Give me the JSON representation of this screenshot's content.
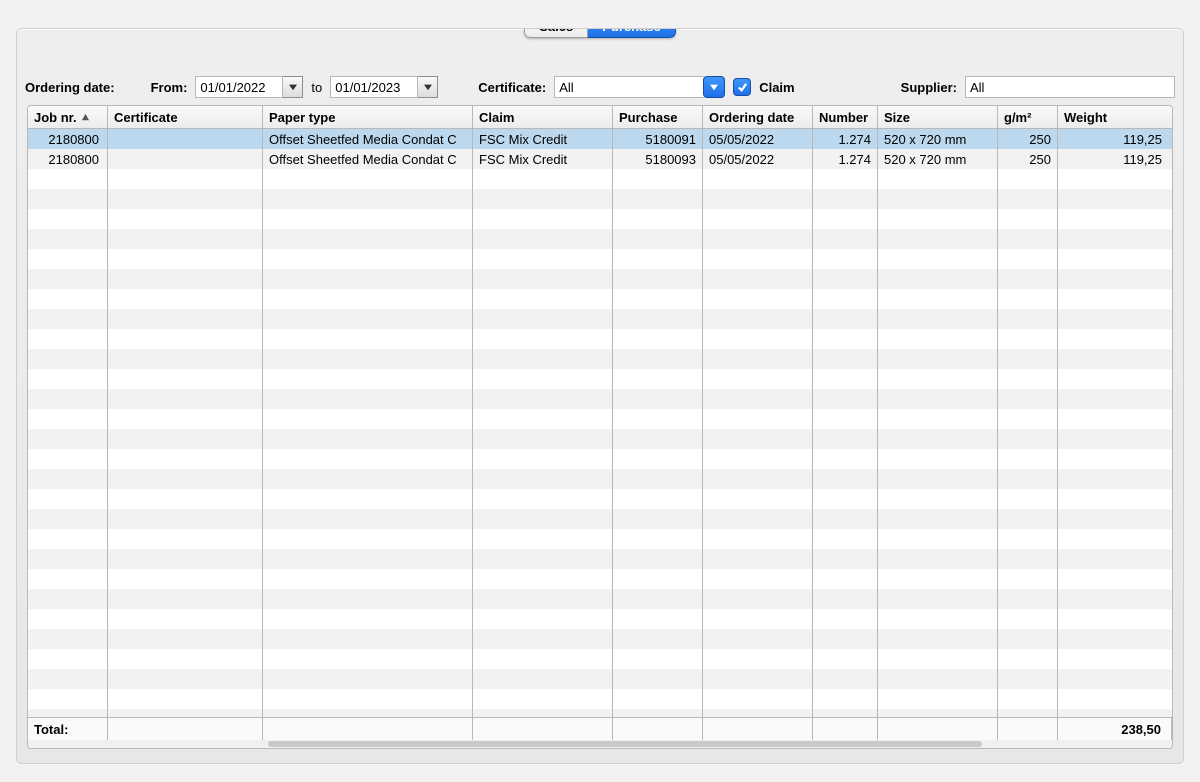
{
  "tabs": {
    "sales": "Sales",
    "purchase": "Purchase",
    "active": "purchase"
  },
  "filters": {
    "ordering_date_label": "Ordering date:",
    "from_label": "From:",
    "from_value": "01/01/2022",
    "to_label": "to",
    "to_value": "01/01/2023",
    "certificate_label": "Certificate:",
    "certificate_value": "All",
    "claim_label": "Claim",
    "claim_checked": true,
    "supplier_label": "Supplier:",
    "supplier_value": "All"
  },
  "columns": [
    "Job nr.",
    "Certificate",
    "Paper type",
    "Claim",
    "Purchase",
    "Ordering date",
    "Number",
    "Size",
    "g/m²",
    "Weight"
  ],
  "sort": {
    "column": 0,
    "dir": "asc"
  },
  "rows": [
    {
      "job": "2180800",
      "cert": "",
      "paper": "Offset Sheetfed Media Condat C",
      "claim": "FSC Mix Credit",
      "purchase": "5180091",
      "date": "05/05/2022",
      "num": "1.274",
      "size": "520 x 720 mm",
      "gm2": "250",
      "weight": "119,25",
      "selected": true
    },
    {
      "job": "2180800",
      "cert": "",
      "paper": "Offset Sheetfed Media Condat C",
      "claim": "FSC Mix Credit",
      "purchase": "5180093",
      "date": "05/05/2022",
      "num": "1.274",
      "size": "520 x 720 mm",
      "gm2": "250",
      "weight": "119,25",
      "selected": false
    }
  ],
  "footer": {
    "label": "Total:",
    "weight": "238,50"
  },
  "blank_row_count": 28
}
